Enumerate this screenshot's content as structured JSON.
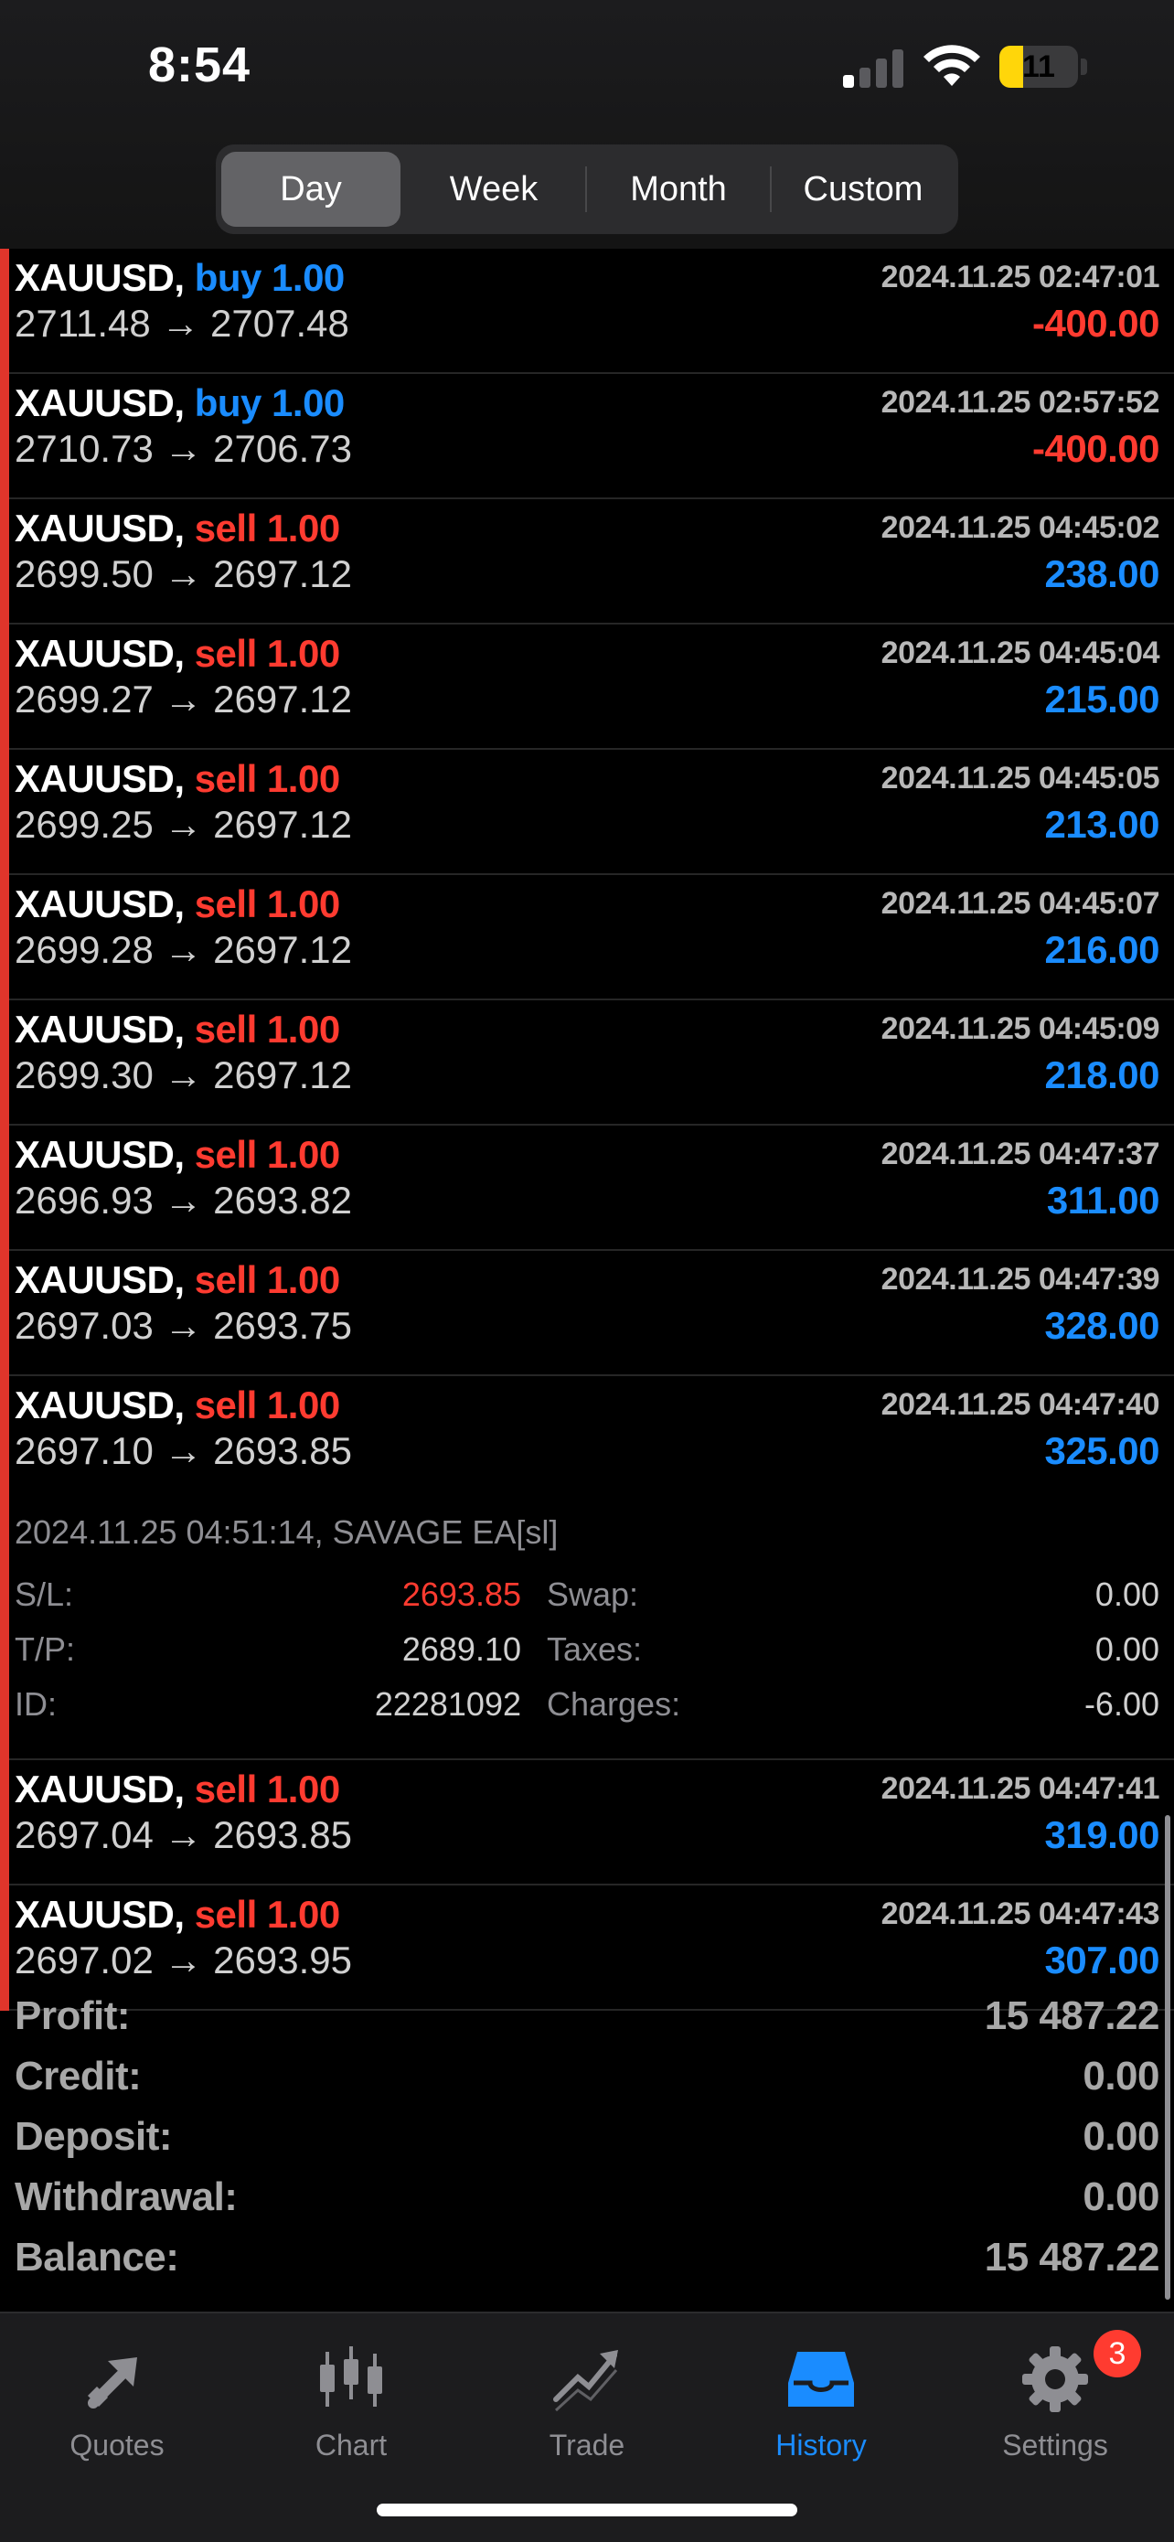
{
  "status_bar": {
    "time": "8:54",
    "battery_level": "11",
    "battery_fraction": 0.3,
    "signal_bars_on": 1
  },
  "period_tabs": [
    {
      "label": "Day",
      "active": true
    },
    {
      "label": "Week",
      "active": false
    },
    {
      "label": "Month",
      "active": false
    },
    {
      "label": "Custom",
      "active": false
    }
  ],
  "trades": [
    {
      "symbol": "XAUUSD,",
      "side": "buy",
      "volume": "buy 1.00",
      "open": "2711.48",
      "close": "2707.48",
      "datetime": "2024.11.25 02:47:01",
      "profit": "-400.00"
    },
    {
      "symbol": "XAUUSD,",
      "side": "buy",
      "volume": "buy 1.00",
      "open": "2710.73",
      "close": "2706.73",
      "datetime": "2024.11.25 02:57:52",
      "profit": "-400.00"
    },
    {
      "symbol": "XAUUSD,",
      "side": "sell",
      "volume": "sell 1.00",
      "open": "2699.50",
      "close": "2697.12",
      "datetime": "2024.11.25 04:45:02",
      "profit": "238.00"
    },
    {
      "symbol": "XAUUSD,",
      "side": "sell",
      "volume": "sell 1.00",
      "open": "2699.27",
      "close": "2697.12",
      "datetime": "2024.11.25 04:45:04",
      "profit": "215.00"
    },
    {
      "symbol": "XAUUSD,",
      "side": "sell",
      "volume": "sell 1.00",
      "open": "2699.25",
      "close": "2697.12",
      "datetime": "2024.11.25 04:45:05",
      "profit": "213.00"
    },
    {
      "symbol": "XAUUSD,",
      "side": "sell",
      "volume": "sell 1.00",
      "open": "2699.28",
      "close": "2697.12",
      "datetime": "2024.11.25 04:45:07",
      "profit": "216.00"
    },
    {
      "symbol": "XAUUSD,",
      "side": "sell",
      "volume": "sell 1.00",
      "open": "2699.30",
      "close": "2697.12",
      "datetime": "2024.11.25 04:45:09",
      "profit": "218.00"
    },
    {
      "symbol": "XAUUSD,",
      "side": "sell",
      "volume": "sell 1.00",
      "open": "2696.93",
      "close": "2693.82",
      "datetime": "2024.11.25 04:47:37",
      "profit": "311.00"
    },
    {
      "symbol": "XAUUSD,",
      "side": "sell",
      "volume": "sell 1.00",
      "open": "2697.03",
      "close": "2693.75",
      "datetime": "2024.11.25 04:47:39",
      "profit": "328.00"
    },
    {
      "symbol": "XAUUSD,",
      "side": "sell",
      "volume": "sell 1.00",
      "open": "2697.10",
      "close": "2693.85",
      "datetime": "2024.11.25 04:47:40",
      "profit": "325.00",
      "details": {
        "close_info": "2024.11.25 04:51:14, SAVAGE EA[sl]",
        "sl_label": "S/L:",
        "sl_value": "2693.85",
        "tp_label": "T/P:",
        "tp_value": "2689.10",
        "id_label": "ID:",
        "id_value": "22281092",
        "swap_label": "Swap:",
        "swap_value": "0.00",
        "taxes_label": "Taxes:",
        "taxes_value": "0.00",
        "charges_label": "Charges:",
        "charges_value": "-6.00"
      }
    },
    {
      "symbol": "XAUUSD,",
      "side": "sell",
      "volume": "sell 1.00",
      "open": "2697.04",
      "close": "2693.85",
      "datetime": "2024.11.25 04:47:41",
      "profit": "319.00"
    },
    {
      "symbol": "XAUUSD,",
      "side": "sell",
      "volume": "sell 1.00",
      "open": "2697.02",
      "close": "2693.95",
      "datetime": "2024.11.25 04:47:43",
      "profit": "307.00"
    }
  ],
  "arrow": "→",
  "summary": [
    {
      "label": "Profit:",
      "value": "15 487.22"
    },
    {
      "label": "Credit:",
      "value": "0.00"
    },
    {
      "label": "Deposit:",
      "value": "0.00"
    },
    {
      "label": "Withdrawal:",
      "value": "0.00"
    },
    {
      "label": "Balance:",
      "value": "15 487.22"
    }
  ],
  "tabs": [
    {
      "label": "Quotes",
      "icon": "quotes-arrows-icon",
      "active": false
    },
    {
      "label": "Chart",
      "icon": "candlestick-icon",
      "active": false
    },
    {
      "label": "Trade",
      "icon": "trend-chart-icon",
      "active": false
    },
    {
      "label": "History",
      "icon": "inbox-tray-icon",
      "active": true
    },
    {
      "label": "Settings",
      "icon": "gear-icon",
      "active": false,
      "badge": "3"
    }
  ],
  "colors": {
    "buy": "#1a8cff",
    "sell": "#ff3b30",
    "accent": "#1a8cff",
    "inactive": "#8e8e93"
  }
}
